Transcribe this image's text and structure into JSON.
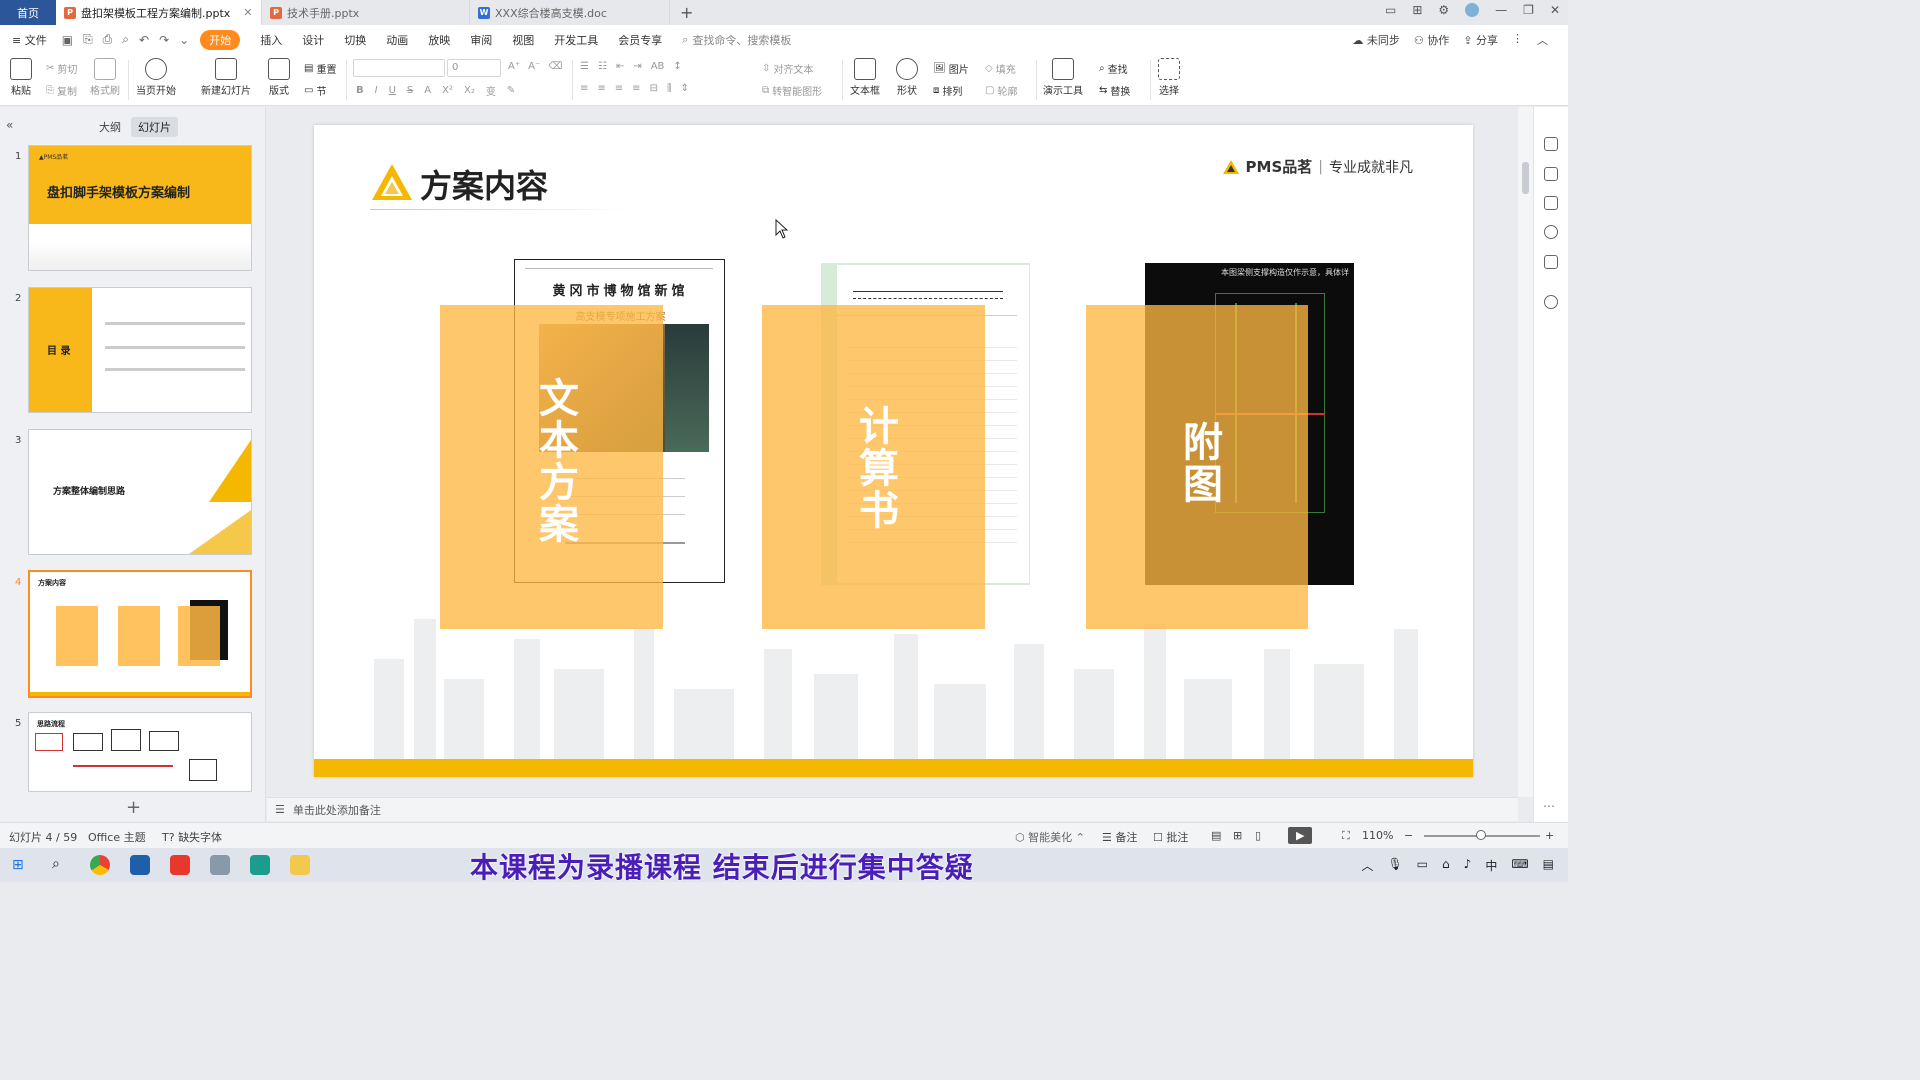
{
  "tabbar": {
    "home": "首页",
    "tabs": [
      {
        "label": "盘扣架模板工程方案编制.pptx",
        "type": "P",
        "active": true
      },
      {
        "label": "技术手册.pptx",
        "type": "P",
        "active": false
      },
      {
        "label": "XXX综合楼高支模.doc",
        "type": "W",
        "active": false
      }
    ]
  },
  "menubar": {
    "file": "文件",
    "start": "开始",
    "items": [
      "插入",
      "设计",
      "切换",
      "动画",
      "放映",
      "审阅",
      "视图",
      "开发工具",
      "会员专享"
    ],
    "search": "查找命令、搜索模板",
    "sync": "未同步",
    "collab": "协作",
    "share": "分享"
  },
  "ribbon": {
    "paste": "粘贴",
    "cut": "剪切",
    "copy": "复制",
    "format_painter": "格式刷",
    "from_current": "当页开始",
    "new_slide": "新建幻灯片",
    "layout": "版式",
    "reset": "重置",
    "section": "节",
    "font_size": "0",
    "align_text": "对齐文本",
    "smartart": "转智能图形",
    "textbox": "文本框",
    "shape": "形状",
    "picture": "图片",
    "arrange": "排列",
    "fill": "填充",
    "outline": "轮廓",
    "present_tools": "演示工具",
    "find": "查找",
    "replace": "替换",
    "select": "选择"
  },
  "leftpanel": {
    "tab_outline": "大纲",
    "tab_slides": "幻灯片",
    "slides": [
      {
        "num": "1",
        "title": "盘扣脚手架模板方案编制"
      },
      {
        "num": "2",
        "title": "目 录"
      },
      {
        "num": "3",
        "title": "方案整体编制思路"
      },
      {
        "num": "4",
        "title": "方案内容"
      },
      {
        "num": "5",
        "title": "思路流程"
      }
    ]
  },
  "slide": {
    "title": "方案内容",
    "brand": "PMS品茗",
    "slogan": "专业成就非凡",
    "cards": [
      {
        "label": "文本方案",
        "doc_title": "黄冈市博物馆新馆",
        "doc_sub": "高支模专项施工方案"
      },
      {
        "label": "计算书"
      },
      {
        "label": "附图",
        "dark_header": "本图梁侧支撑构造仅作示意，具体详"
      }
    ]
  },
  "notes": {
    "placeholder": "单击此处添加备注"
  },
  "status": {
    "slide_info": "幻灯片 4 / 59",
    "theme": "Office 主题",
    "missing_font": "缺失字体",
    "beautify": "智能美化",
    "notes": "备注",
    "comments": "批注",
    "zoom": "110%"
  },
  "taskbar": {
    "subtitle": "本课程为录播课程 结束后进行集中答疑",
    "ime": "中"
  },
  "colors": {
    "accent": "#ff8a1e",
    "gold": "#f5b800",
    "overlay": "#ffb742",
    "home_tab": "#2b579a"
  }
}
